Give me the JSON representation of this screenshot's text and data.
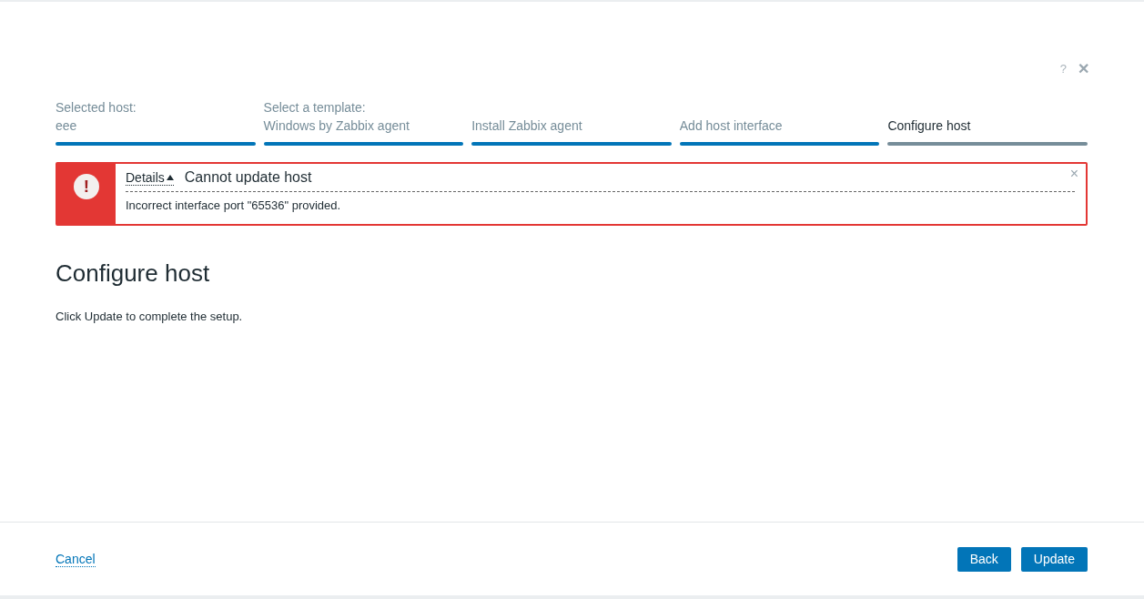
{
  "header": {
    "help": "?",
    "close": "✕"
  },
  "steps": [
    {
      "lines": [
        "Selected host:",
        "eee"
      ],
      "current": false
    },
    {
      "lines": [
        "Select a template:",
        "Windows by Zabbix agent"
      ],
      "current": false
    },
    {
      "lines": [
        "Install Zabbix agent"
      ],
      "current": false
    },
    {
      "lines": [
        "Add host interface"
      ],
      "current": false
    },
    {
      "lines": [
        "Configure host"
      ],
      "current": true
    }
  ],
  "error": {
    "icon": "!",
    "details": "Details",
    "expanded": true,
    "title": "Cannot update host",
    "close": "×",
    "messages": [
      "Incorrect interface port \"65536\" provided."
    ]
  },
  "heading": "Configure host",
  "description": "Click Update to complete the setup.",
  "footer": {
    "cancel": "Cancel",
    "buttons": [
      "Back",
      "Update"
    ]
  }
}
